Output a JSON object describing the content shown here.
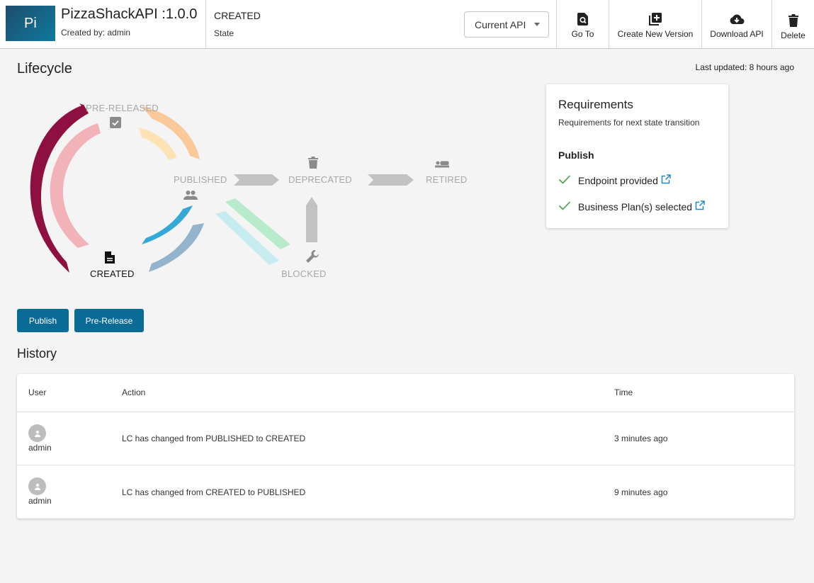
{
  "header": {
    "avatar_text": "Pi",
    "api_title": "PizzaShackAPI :1.0.0",
    "created_by": "Created by: admin",
    "state_value": "CREATED",
    "state_label": "State",
    "version_select": "Current API",
    "actions": {
      "goto": "Go To",
      "create_version": "Create New Version",
      "download": "Download API",
      "delete": "Delete"
    }
  },
  "lifecycle": {
    "title": "Lifecycle",
    "last_updated": "Last updated: 8 hours ago",
    "states": {
      "pre_released": "PRE-RELEASED",
      "published": "PUBLISHED",
      "deprecated": "DEPRECATED",
      "retired": "RETIRED",
      "created": "CREATED",
      "blocked": "BLOCKED"
    },
    "current_state": "CREATED"
  },
  "requirements": {
    "title": "Requirements",
    "subtitle": "Requirements for next state transition",
    "section": "Publish",
    "items": [
      "Endpoint provided",
      "Business Plan(s) selected"
    ]
  },
  "buttons": {
    "publish": "Publish",
    "pre_release": "Pre-Release"
  },
  "history": {
    "title": "History",
    "columns": {
      "user": "User",
      "action": "Action",
      "time": "Time"
    },
    "rows": [
      {
        "user": "admin",
        "action": "LC has changed from PUBLISHED to CREATED",
        "time": "3 minutes ago"
      },
      {
        "user": "admin",
        "action": "LC has changed from CREATED to PUBLISHED",
        "time": "9 minutes ago"
      }
    ]
  },
  "colors": {
    "primary_button": "#0a6b96",
    "check_green": "#43a047",
    "link_blue": "#1e88c8"
  }
}
